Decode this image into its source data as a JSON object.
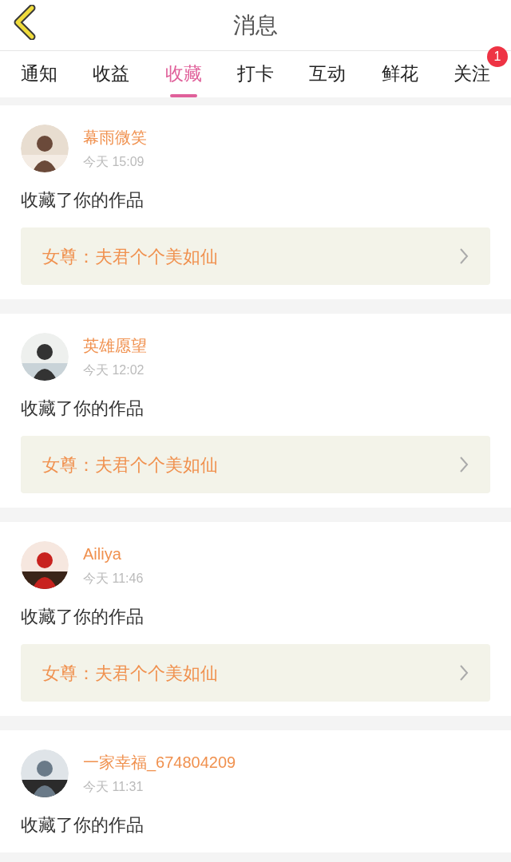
{
  "header": {
    "title": "消息"
  },
  "tabs": [
    {
      "label": "通知",
      "selected": false
    },
    {
      "label": "收益",
      "selected": false
    },
    {
      "label": "收藏",
      "selected": true
    },
    {
      "label": "打卡",
      "selected": false
    },
    {
      "label": "互动",
      "selected": false
    },
    {
      "label": "鲜花",
      "selected": false
    },
    {
      "label": "关注",
      "selected": false,
      "badge": "1"
    }
  ],
  "messages": [
    {
      "user": "幕雨微笑",
      "time": "今天 15:09",
      "action": "收藏了你的作品",
      "work": "女尊：夫君个个美如仙"
    },
    {
      "user": "英雄愿望",
      "time": "今天 12:02",
      "action": "收藏了你的作品",
      "work": "女尊：夫君个个美如仙"
    },
    {
      "user": "Ailiya",
      "time": "今天 11:46",
      "action": "收藏了你的作品",
      "work": "女尊：夫君个个美如仙"
    },
    {
      "user": "一家幸福_674804209",
      "time": "今天 11:31",
      "action": "收藏了你的作品"
    }
  ]
}
